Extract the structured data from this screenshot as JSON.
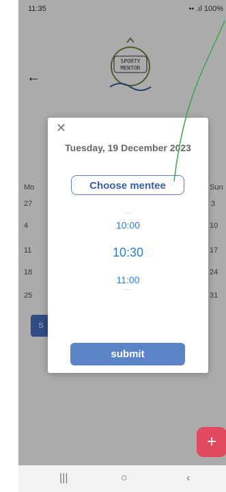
{
  "status_bar": {
    "time": "11:35",
    "icons_right": "•• .ıl 100%"
  },
  "calendar": {
    "weekday_first": "Mo",
    "weekday_last": "Sun",
    "rows": [
      {
        "left": "27",
        "right": "3"
      },
      {
        "left": "4",
        "right": "10"
      },
      {
        "left": "11",
        "right": "17"
      },
      {
        "left": "18",
        "right": "24"
      },
      {
        "left": "25",
        "right": "31"
      }
    ],
    "side_button_label": "S"
  },
  "modal": {
    "date_title": "Tuesday, 19 December 2023",
    "choose_mentee_label": "Choose mentee",
    "times": {
      "prev": "10:00",
      "selected": "10:30",
      "next": "11:00"
    },
    "submit_label": "submit"
  },
  "fab_label": "+",
  "nav": {
    "recent": "|||",
    "home": "○",
    "back": "‹"
  },
  "colors": {
    "accent": "#5b84c6",
    "fab": "#e14a5f",
    "picker": "#2a7fd4",
    "arrow": "#3aa64a"
  }
}
